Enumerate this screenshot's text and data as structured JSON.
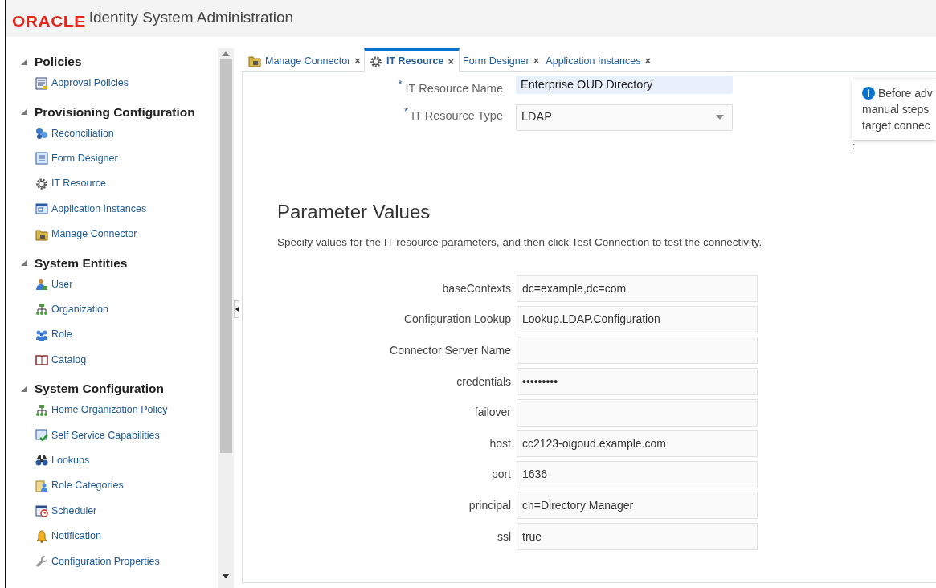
{
  "header": {
    "logo": "ORACLE",
    "title": "Identity System Administration"
  },
  "sidebar": {
    "sections": [
      {
        "title": "Policies",
        "expanded": true,
        "items": [
          {
            "label": "Approval Policies",
            "kind": "approval"
          }
        ]
      },
      {
        "title": "Provisioning Configuration",
        "expanded": true,
        "items": [
          {
            "label": "Reconciliation",
            "kind": "recon"
          },
          {
            "label": "Form Designer",
            "kind": "form"
          },
          {
            "label": "IT Resource",
            "kind": "gear"
          },
          {
            "label": "Application Instances",
            "kind": "app"
          },
          {
            "label": "Manage Connector",
            "kind": "folder"
          }
        ]
      },
      {
        "title": "System Entities",
        "expanded": true,
        "items": [
          {
            "label": "User",
            "kind": "user"
          },
          {
            "label": "Organization",
            "kind": "org"
          },
          {
            "label": "Role",
            "kind": "role"
          },
          {
            "label": "Catalog",
            "kind": "book"
          }
        ]
      },
      {
        "title": "System Configuration",
        "expanded": true,
        "items": [
          {
            "label": "Home Organization Policy",
            "kind": "org"
          },
          {
            "label": "Self Service Capabilities",
            "kind": "check"
          },
          {
            "label": "Lookups",
            "kind": "binoculars"
          },
          {
            "label": "Role Categories",
            "kind": "rolecat"
          },
          {
            "label": "Scheduler",
            "kind": "clock"
          },
          {
            "label": "Notification",
            "kind": "bell"
          },
          {
            "label": "Configuration Properties",
            "kind": "wrench"
          }
        ]
      }
    ]
  },
  "tabs": [
    {
      "label": "Manage Connector",
      "kind": "folder",
      "close": "×",
      "selected": false
    },
    {
      "label": "IT Resource",
      "kind": "gear",
      "close": "×",
      "selected": true
    },
    {
      "label": "Form Designer",
      "close": "×",
      "selected": false
    },
    {
      "label": "Application Instances",
      "close": "×",
      "selected": false
    }
  ],
  "resource": {
    "fields": [
      {
        "label": "IT Resource Name",
        "required": "*",
        "kind": "text",
        "value": "Enterprise OUD Directory"
      },
      {
        "label": "IT Resource Type",
        "required": "*",
        "kind": "select",
        "value": "LDAP"
      }
    ],
    "info": {
      "lines": [
        "Before adv",
        "manual steps",
        "target connec"
      ],
      "mark": ":"
    }
  },
  "parameters": {
    "title": "Parameter Values",
    "description": "Specify values for the IT resource parameters, and then click Test Connection to test the connectivity.",
    "fields": [
      {
        "label": "baseContexts",
        "value": "dc=example,dc=com"
      },
      {
        "label": "Configuration Lookup",
        "value": "Lookup.LDAP.Configuration"
      },
      {
        "label": "Connector Server Name"
      },
      {
        "label": "credentials",
        "value": "•••••••••"
      },
      {
        "label": "failover"
      },
      {
        "label": "host",
        "value": "cc2123-oigoud.example.com"
      },
      {
        "label": "port",
        "value": "1636"
      },
      {
        "label": "principal",
        "value": "cn=Directory Manager"
      },
      {
        "label": "ssl",
        "value": "true"
      }
    ]
  }
}
